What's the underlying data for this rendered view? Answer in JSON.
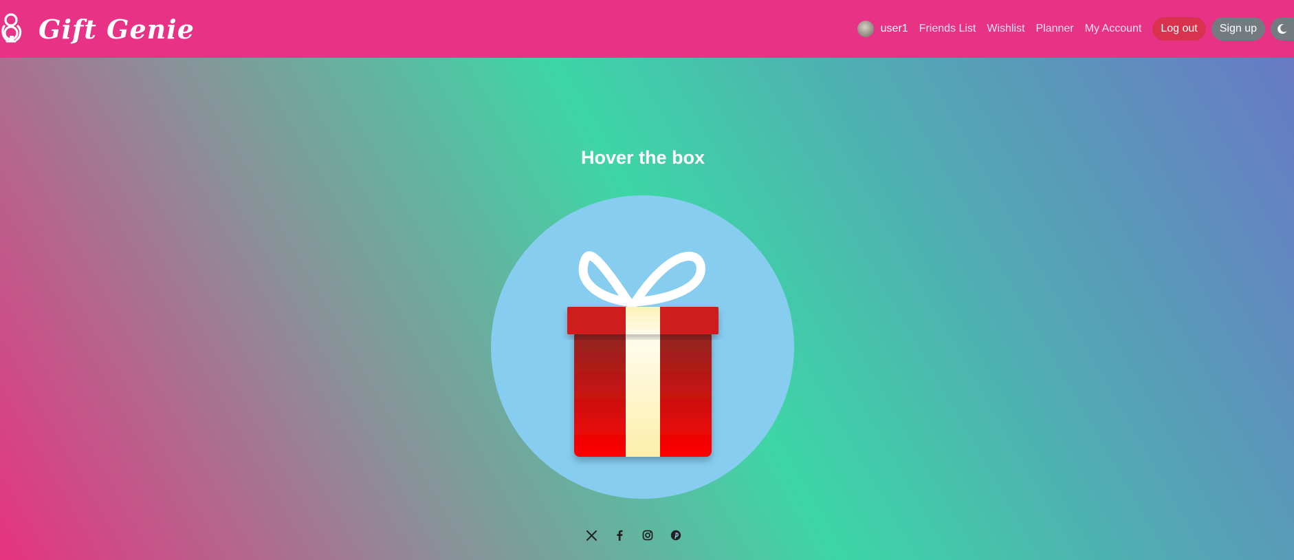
{
  "brand": {
    "name": "Gift Genie",
    "logo_icon": "genie-lamp-logo-icon"
  },
  "nav": {
    "user_name": "user1",
    "links": [
      "Friends List",
      "Wishlist",
      "Planner",
      "My Account"
    ],
    "logout_label": "Log out",
    "signup_label": "Sign up",
    "theme_icon": "moon-icon"
  },
  "hero": {
    "title": "Hover the box",
    "gift_icon": "gift-box-icon"
  },
  "footer": {
    "social_icons": [
      "x-icon",
      "facebook-icon",
      "instagram-icon",
      "pinterest-icon"
    ]
  },
  "colors": {
    "navbar": "#e83285",
    "logout": "#d9324f",
    "signup": "#737a80",
    "circle": "#87cdef",
    "box_red": "#cf1f1f",
    "ribbon": "#fff6c8"
  }
}
